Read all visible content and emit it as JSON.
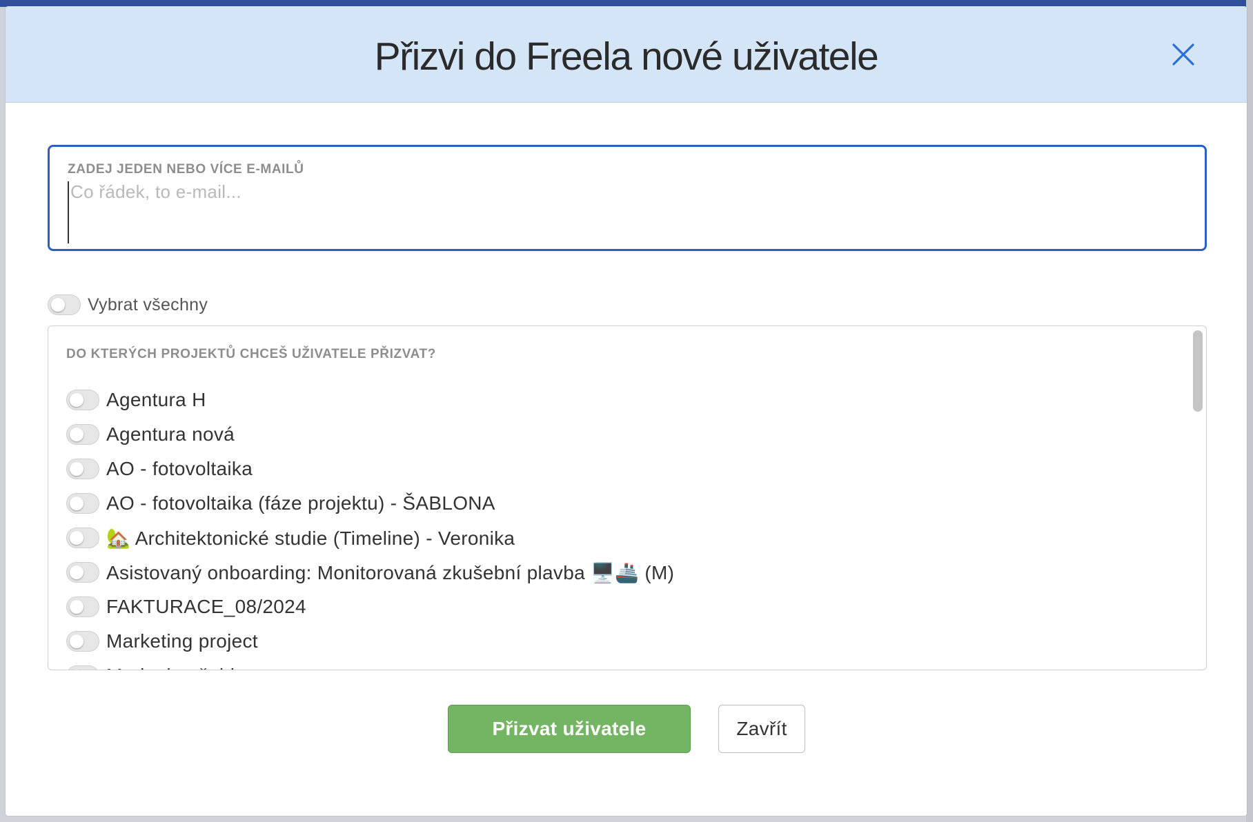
{
  "modal": {
    "title": "Přizvi do Freela nové uživatele",
    "close_icon": "close-icon"
  },
  "email": {
    "label": "ZADEJ JEDEN NEBO VÍCE E-MAILŮ",
    "placeholder": "Co řádek, to e-mail...",
    "value": ""
  },
  "select_all": {
    "label": "Vybrat všechny",
    "checked": false
  },
  "projects": {
    "label": "DO KTERÝCH PROJEKTŮ CHCEŠ UŽIVATELE PŘIZVAT?",
    "items": [
      {
        "label": "Agentura H",
        "checked": false
      },
      {
        "label": "Agentura nová",
        "checked": false
      },
      {
        "label": "AO - fotovoltaika",
        "checked": false
      },
      {
        "label": "AO - fotovoltaika (fáze projektu) - ŠABLONA",
        "checked": false
      },
      {
        "label": "🏡 Architektonické studie (Timeline) - Veronika",
        "checked": false
      },
      {
        "label": "Asistovaný onboarding: Monitorovaná zkušební plavba 🖥️🚢 (M)",
        "checked": false
      },
      {
        "label": "FAKTURACE_08/2024",
        "checked": false
      },
      {
        "label": "Marketing project",
        "checked": false
      },
      {
        "label": "Marketing šablona",
        "checked": false
      }
    ]
  },
  "actions": {
    "invite_label": "Přizvat uživatele",
    "close_label": "Zavřít"
  },
  "colors": {
    "header_bg": "#d5e5f8",
    "accent_blue": "#2b5fc5",
    "invite_green": "#74b563"
  }
}
